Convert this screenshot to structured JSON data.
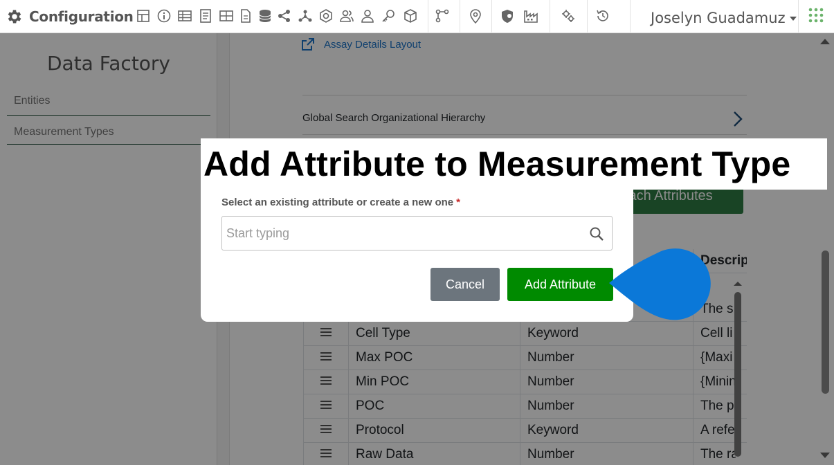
{
  "app": {
    "title": "Configuration",
    "user_name": "Joselyn Guadamuz"
  },
  "toolbar_icons": [
    "layout-icon",
    "info-icon",
    "table-icon",
    "document-icon",
    "grid-icon",
    "file-icon",
    "database-icon",
    "share-icon",
    "network-icon",
    "hexagon-icon",
    "users-icon",
    "user-icon",
    "key-icon",
    "cube-icon",
    "branch-icon",
    "location-pin-icon",
    "shield-icon",
    "factory-icon",
    "settings-icon",
    "history-icon",
    "apps-grid-icon"
  ],
  "sidebar": {
    "title": "Data Factory",
    "items": [
      {
        "label": "Entities"
      },
      {
        "label": "Measurement Types"
      }
    ]
  },
  "main": {
    "assay_link": "Assay Details Layout",
    "global_search": "Global Search Organizational Hierarchy",
    "attach_button": "Attach Attributes",
    "table": {
      "header_desc": "Description",
      "rows": [
        {
          "name": "",
          "type": "",
          "desc": "The s"
        },
        {
          "name": "Cell Type",
          "type": "Keyword",
          "desc": "Cell li"
        },
        {
          "name": "Max POC",
          "type": "Number",
          "desc": "{Maxi"
        },
        {
          "name": "Min POC",
          "type": "Number",
          "desc": "{Minin"
        },
        {
          "name": "POC",
          "type": "Number",
          "desc": "The p"
        },
        {
          "name": "Protocol",
          "type": "Keyword",
          "desc": "A refe"
        },
        {
          "name": "Raw Data",
          "type": "Number",
          "desc": "The ra"
        }
      ]
    }
  },
  "modal": {
    "title": "Add Attribute to Measurement Type",
    "field_label": "Select an existing attribute or create a new one",
    "required_mark": "*",
    "search_placeholder": "Start typing",
    "cancel_label": "Cancel",
    "add_label": "Add Attribute"
  },
  "colors": {
    "primary_green": "#008a00",
    "attach_green": "#2e7d44",
    "cancel_gray": "#6c757d",
    "link_blue": "#1a73c8",
    "pointer_blue": "#0b78d8"
  }
}
